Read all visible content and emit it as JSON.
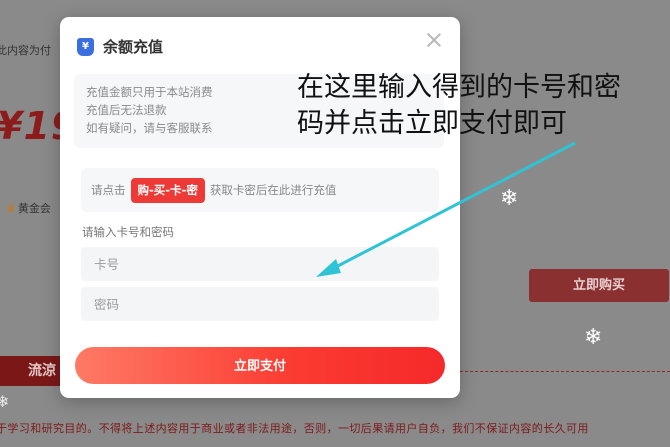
{
  "background": {
    "note_fragment": "此内容为付",
    "price_fragment": "¥19.",
    "vip_label": "黄金会",
    "buy_now_label": "立即购买",
    "tab_fragment": "流涼",
    "disclaimer": "于学习和研究目的。不得将上述内容用于商业或者非法用途，否则，一切后果请用户自负，我们不保证内容的长久可用",
    "disclaimer_line2": "...",
    "crown_icon": "crown-icon",
    "snowflake_icon": "snowflake-icon"
  },
  "modal": {
    "title": "余额充值",
    "title_icon": "wallet-icon",
    "notice_lines": [
      "充值金额只用于本站消费",
      "充值后无法退款",
      "如有疑问，请与客服联系"
    ],
    "redeem": {
      "prefix": "请点击",
      "button_label": "购-买-卡-密",
      "suffix": "获取卡密后在此进行充值"
    },
    "input_label": "请输入卡号和密码",
    "card_placeholder": "卡号",
    "password_placeholder": "密码",
    "pay_button_label": "立即支付"
  },
  "annotation": {
    "line1": "在这里输入得到的卡号和密",
    "line2": "码并点击立即支付即可",
    "arrow_color": "#2ec4d6"
  },
  "colors": {
    "accent_red": "#ee3a36",
    "wallet_blue": "#3b6fe0"
  }
}
